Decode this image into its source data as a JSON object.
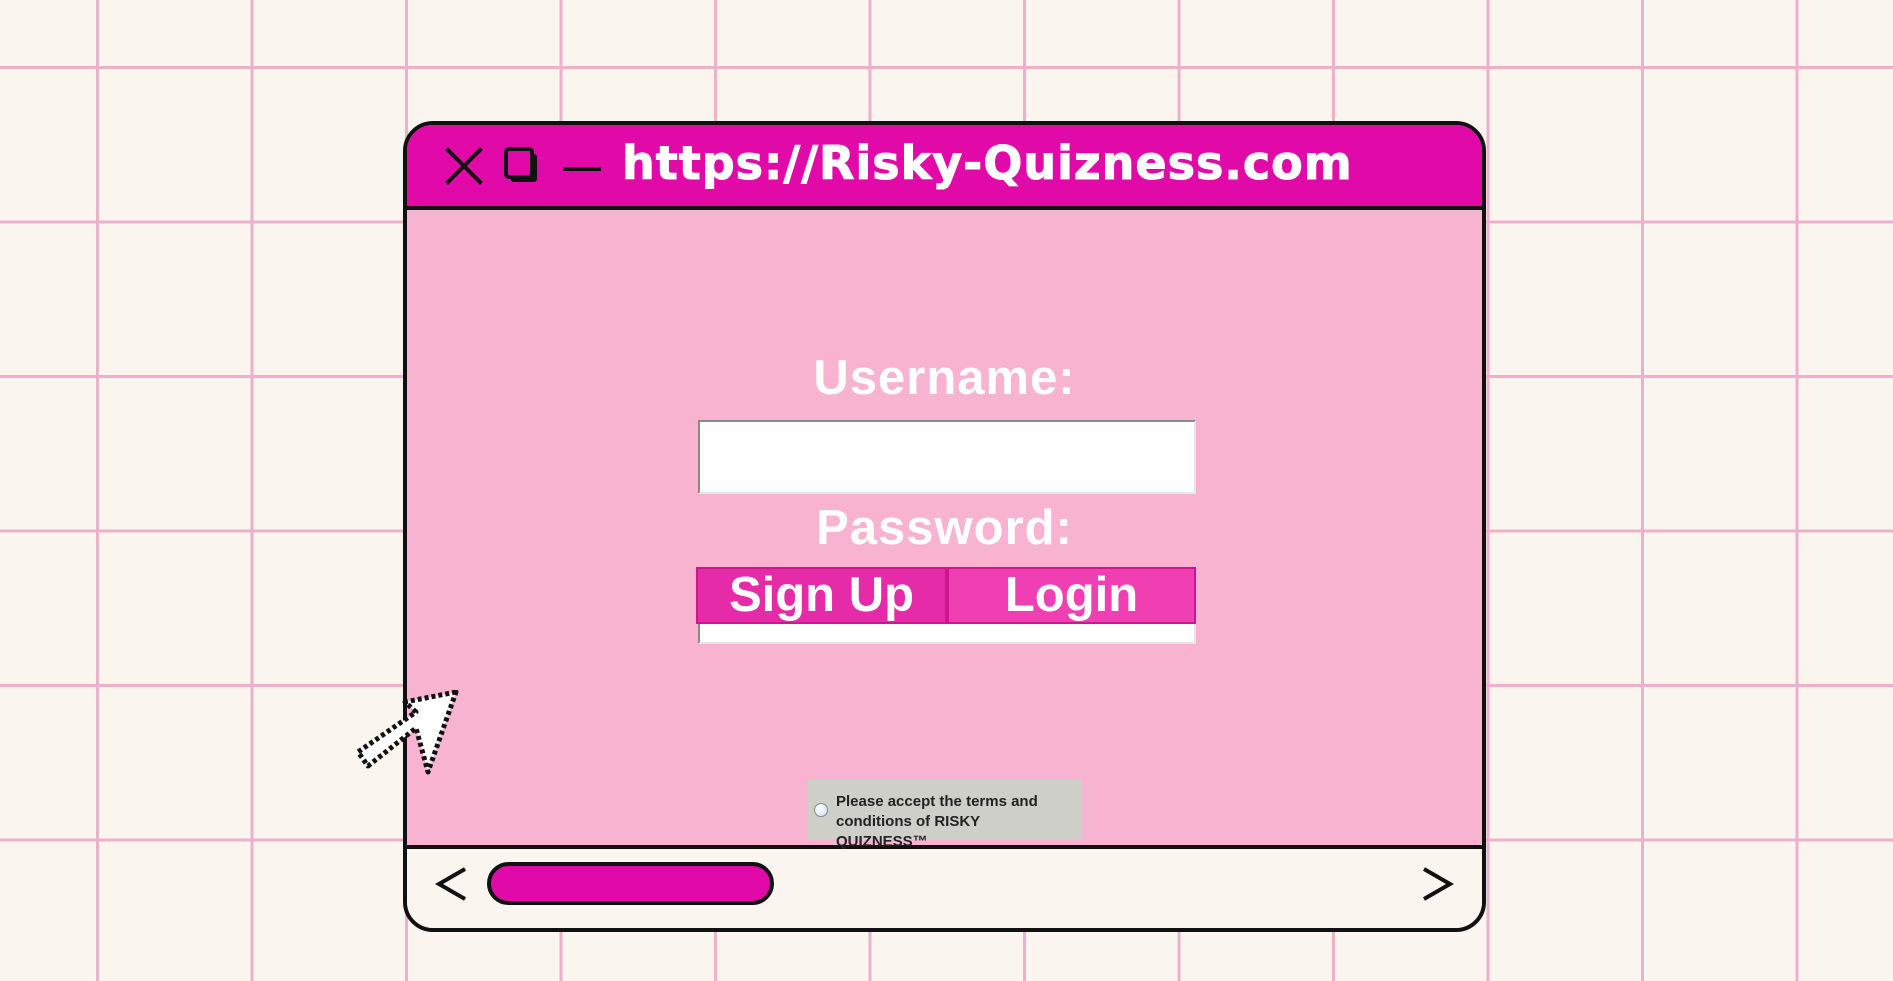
{
  "window": {
    "url": "https://Risky-Quizness.com",
    "icons": {
      "close": "close-icon",
      "maximize": "maximize-icon",
      "minimize": "minimize-icon"
    }
  },
  "form": {
    "username_label": "Username:",
    "username_value": "",
    "password_label": "Password:",
    "password_value": "",
    "signup_label": "Sign Up",
    "login_label": "Login",
    "terms_text": "Please accept the terms and conditions of RISKY QUIZNESS™"
  },
  "statusbar": {
    "scroll_left": "<",
    "scroll_right": ">"
  },
  "colors": {
    "background": "#fbf5ef",
    "grid_line": "#eeb1cc",
    "titlebar": "#e10aa8",
    "window_body": "#f8b3d0",
    "signup_button": "#e52ba8",
    "login_button": "#f03fb2",
    "terms_box": "#cfcfc9",
    "scroll_thumb": "#e10aa8",
    "outline": "#111111"
  }
}
